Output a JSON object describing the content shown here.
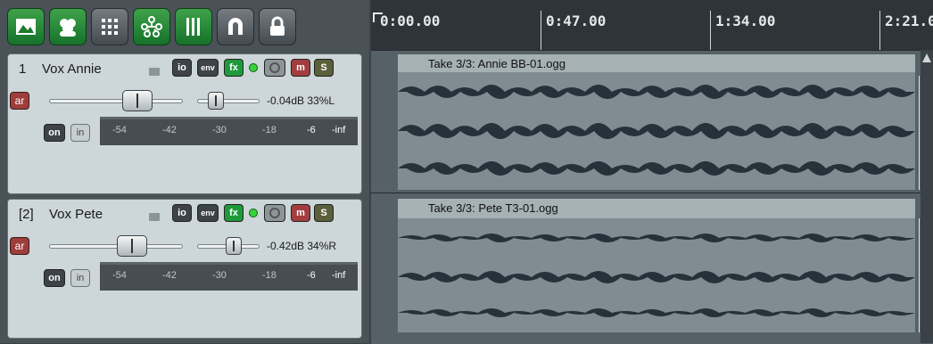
{
  "toolbar": {
    "buttons": [
      {
        "icon": "image-icon"
      },
      {
        "icon": "people-icon"
      },
      {
        "icon": "grid-icon"
      },
      {
        "icon": "routing-icon"
      },
      {
        "icon": "bars-icon"
      },
      {
        "icon": "snap-magnet-icon"
      },
      {
        "icon": "lock-icon"
      }
    ]
  },
  "tracks": [
    {
      "number": "1",
      "name": "Vox Annie",
      "io_label": "io",
      "env_label": "env",
      "fx_label": "fx",
      "mute_label": "m",
      "solo_label": "S",
      "ar_label": "ar",
      "volume_readout": "-0.04dB 33%L",
      "on_label": "on",
      "in_label": "in",
      "meter_ticks": [
        "-54",
        "-42",
        "-30",
        "-18",
        "-6",
        "-inf"
      ]
    },
    {
      "number": "[2]",
      "name": "Vox Pete",
      "io_label": "io",
      "env_label": "env",
      "fx_label": "fx",
      "mute_label": "m",
      "solo_label": "S",
      "ar_label": "ar",
      "volume_readout": "-0.42dB 34%R",
      "on_label": "on",
      "in_label": "in",
      "meter_ticks": [
        "-54",
        "-42",
        "-30",
        "-18",
        "-6",
        "-inf"
      ]
    }
  ],
  "ruler": {
    "times": [
      "0:00.00",
      "0:47.00",
      "1:34.00",
      "2:21.0"
    ]
  },
  "items": [
    {
      "title": "Take 3/3: Annie BB-01.ogg"
    },
    {
      "title": "Take 3/3: Pete T3-01.ogg"
    }
  ],
  "colors": {
    "toolbar_green": "#2e8f3c",
    "fx_green": "#1f9a3b",
    "mute_red": "#a43e3e",
    "waveform": "#27313a",
    "item_bg": "#a5b1b4"
  }
}
